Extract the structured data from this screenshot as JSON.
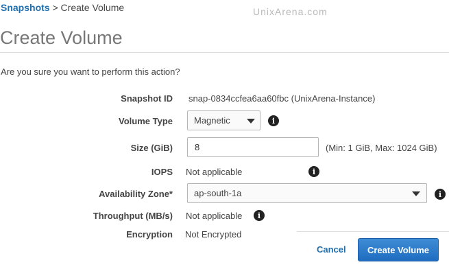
{
  "breadcrumb": {
    "parent": "Snapshots",
    "separator": ">",
    "current": "Create Volume"
  },
  "watermark": "UnixArena.com",
  "page_title": "Create Volume",
  "confirm_text": "Are you sure you want to perform this action?",
  "fields": {
    "snapshot_id": {
      "label": "Snapshot ID",
      "value": "snap-0834ccfea6aa60fbc (UnixArena-Instance)"
    },
    "volume_type": {
      "label": "Volume Type",
      "value": "Magnetic"
    },
    "size": {
      "label": "Size (GiB)",
      "value": "8",
      "hint": "(Min: 1 GiB, Max: 1024 GiB)"
    },
    "iops": {
      "label": "IOPS",
      "value": "Not applicable"
    },
    "availability_zone": {
      "label": "Availability Zone*",
      "value": "ap-south-1a"
    },
    "throughput": {
      "label": "Throughput (MB/s)",
      "value": "Not applicable"
    },
    "encryption": {
      "label": "Encryption",
      "value": "Not Encrypted"
    }
  },
  "info_icon_glyph": "i",
  "actions": {
    "cancel": "Cancel",
    "create": "Create Volume"
  },
  "colors": {
    "link": "#1f6ead",
    "primary_button": "#1f6cc0",
    "title": "#777777"
  }
}
